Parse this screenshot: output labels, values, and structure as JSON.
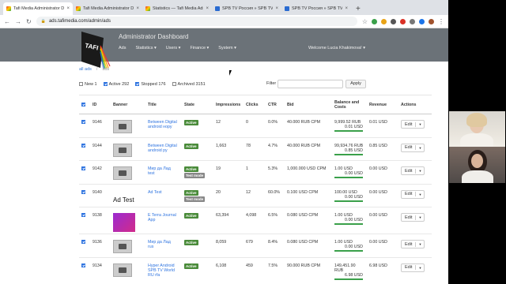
{
  "browser": {
    "tabs": [
      {
        "title": "Tafi Media Administrator Dashb",
        "active": true,
        "favicon": "dashboard-favicon"
      },
      {
        "title": "Tafi Media Administrator Dashb",
        "active": false,
        "favicon": "dashboard-favicon"
      },
      {
        "title": "Statistics — Tafi Media Admin",
        "active": false,
        "favicon": "dashboard-favicon"
      },
      {
        "title": "SPB TV Россия » SPB TV Росс",
        "active": false,
        "favicon": "tv-favicon"
      },
      {
        "title": "SPB TV Россия » SPB TV Росс",
        "active": false,
        "favicon": "tv-favicon"
      }
    ],
    "url": "ads.tafimedia.com/admin/ads"
  },
  "header": {
    "logo_text": "TAFI",
    "title": "Administrator Dashboard",
    "nav": [
      "Ads",
      "Statistics ▾",
      "Users ▾",
      "Finance ▾",
      "System ▾"
    ],
    "welcome": "Welcome Lucia Khakimova! ▾",
    "background": "#6b7278"
  },
  "breadcrumb": {
    "root": "all ads",
    "current": "ads"
  },
  "filters": {
    "new": {
      "label": "New",
      "count": "1",
      "checked": false
    },
    "active": {
      "label": "Active",
      "count": "292",
      "checked": true
    },
    "stopped": {
      "label": "Stopped",
      "count": "176",
      "checked": true
    },
    "archived": {
      "label": "Archived",
      "count": "3151",
      "checked": false
    },
    "filter_label": "Filter",
    "apply_label": "Apply"
  },
  "table": {
    "headers": {
      "id": "ID",
      "banner": "Banner",
      "title": "Title",
      "state": "State",
      "impressions": "Impressions",
      "clicks": "Clicks",
      "ctr": "CTR",
      "bid": "Bid",
      "balance": "Balance and Costs",
      "revenue": "Revenue",
      "actions": "Actions"
    },
    "rows": [
      {
        "id": "9146",
        "banner": "image",
        "title": [
          "Between Digital",
          "android нору"
        ],
        "state": [
          "Active"
        ],
        "impressions": "12",
        "clicks": "0",
        "ctr": "0.0%",
        "bid": "40.000 RUB CPM",
        "balance": "9,999.52 RUB",
        "cost": "0.01 USD",
        "revenue": "0.01 USD",
        "edit": "Edit"
      },
      {
        "id": "9144",
        "banner": "image",
        "title": [
          "Between Digital",
          "android ру"
        ],
        "state": [
          "Active"
        ],
        "impressions": "1,663",
        "clicks": "78",
        "ctr": "4.7%",
        "bid": "40.000 RUB CPM",
        "balance": "99,934.76 RUB",
        "cost": "0.85 USD",
        "revenue": "0.85 USD",
        "edit": "Edit"
      },
      {
        "id": "9142",
        "banner": "image",
        "title": [
          "Мир да Лад",
          "test"
        ],
        "state": [
          "Active",
          "Test mode"
        ],
        "impressions": "19",
        "clicks": "1",
        "ctr": "5.3%",
        "bid": "1,000.000 USD CPM",
        "balance": "1.00 USD",
        "cost": "0.00 USD",
        "revenue": "0.00 USD",
        "edit": "Edit"
      },
      {
        "id": "9140",
        "banner": "Ad Test",
        "title": [
          "Ad Test"
        ],
        "state": [
          "Active",
          "Test mode"
        ],
        "impressions": "20",
        "clicks": "12",
        "ctr": "60.0%",
        "bid": "0.100 USD CPM",
        "balance": "100.00 USD",
        "cost": "0.00 USD",
        "revenue": "0.00 USD",
        "edit": "Edit"
      },
      {
        "id": "9138",
        "banner": "promo",
        "title": [
          "E Terra Journal",
          "App"
        ],
        "state": [
          "Active"
        ],
        "impressions": "63,394",
        "clicks": "4,098",
        "ctr": "6.5%",
        "bid": "0.080 USD CPM",
        "balance": "1.00 USD",
        "cost": "0.00 USD",
        "revenue": "0.00 USD",
        "edit": "Edit"
      },
      {
        "id": "9136",
        "banner": "image",
        "title": [
          "Мир да Лад",
          "rus"
        ],
        "state": [
          "Active"
        ],
        "impressions": "8,059",
        "clicks": "679",
        "ctr": "8.4%",
        "bid": "0.080 USD CPM",
        "balance": "1.00 USD",
        "cost": "0.00 USD",
        "revenue": "0.00 USD",
        "edit": "Edit"
      },
      {
        "id": "9134",
        "banner": "image",
        "title": [
          "Hyper Android",
          "SPB TV World",
          "RU rfa"
        ],
        "state": [
          "Active"
        ],
        "impressions": "6,108",
        "clicks": "459",
        "ctr": "7.5%",
        "bid": "90.000 RUB CPM",
        "balance": "149,451.90 RUB",
        "cost": "6.98 USD",
        "revenue": "6.98 USD",
        "edit": "Edit"
      }
    ]
  },
  "colors": {
    "link": "#2f74e0",
    "active_badge": "#4a8b3a",
    "test_badge": "#888888",
    "balance_bar": "#3aa04a"
  }
}
